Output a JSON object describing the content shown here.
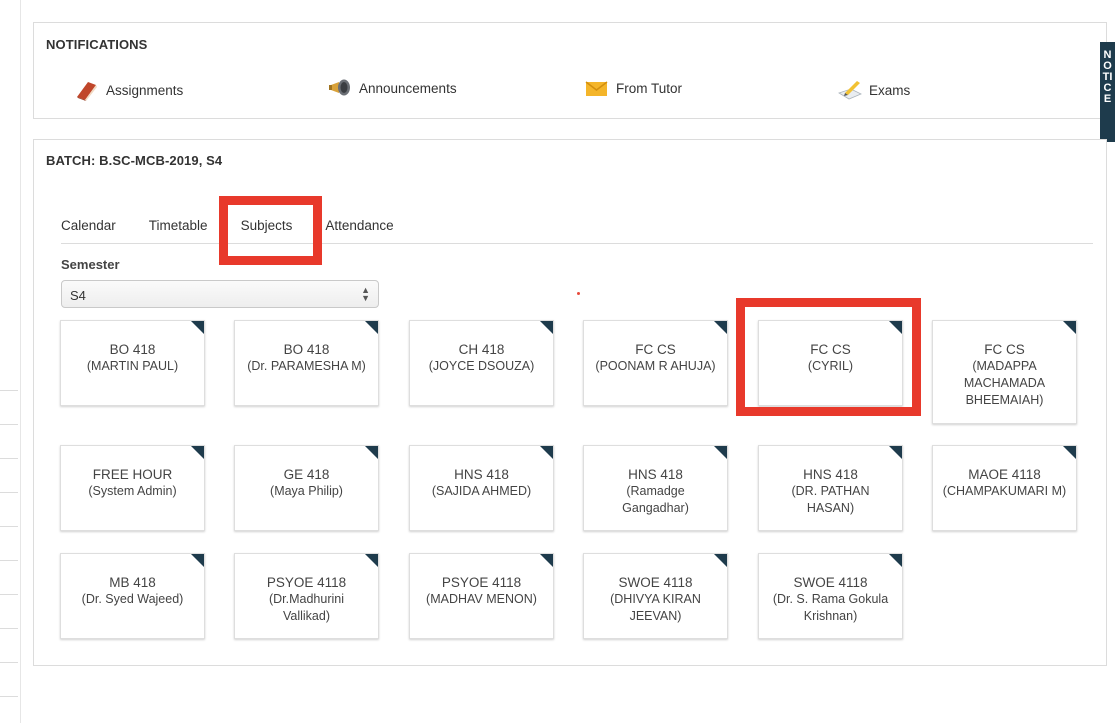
{
  "notifications": {
    "title": "NOTIFICATIONS",
    "items": [
      {
        "label": "Assignments",
        "icon": "book-icon"
      },
      {
        "label": "Announcements",
        "icon": "megaphone-icon"
      },
      {
        "label": "From Tutor",
        "icon": "envelope-icon"
      },
      {
        "label": "Exams",
        "icon": "pencil-paper-icon"
      }
    ]
  },
  "notice_tab": {
    "label": "NOTICE"
  },
  "batch": {
    "title": "BATCH: B.SC-MCB-2019, S4",
    "tabs": [
      "Calendar",
      "Timetable",
      "Subjects",
      "Attendance"
    ],
    "active_tab": "Subjects",
    "semester_label": "Semester",
    "semester_value": "S4"
  },
  "subjects": [
    {
      "code": "BO 418",
      "teacher": "(MARTIN PAUL)"
    },
    {
      "code": "BO 418",
      "teacher": "(Dr. PARAMESHA M)"
    },
    {
      "code": "CH 418",
      "teacher": "(JOYCE DSOUZA)"
    },
    {
      "code": "FC CS",
      "teacher": "(POONAM R AHUJA)"
    },
    {
      "code": "FC CS",
      "teacher": "(CYRIL)"
    },
    {
      "code": "FC CS",
      "teacher": "(MADAPPA MACHAMADA BHEEMAIAH)"
    },
    {
      "code": "FREE HOUR",
      "teacher": "(System Admin)"
    },
    {
      "code": "GE 418",
      "teacher": "(Maya Philip)"
    },
    {
      "code": "HNS 418",
      "teacher": "(SAJIDA AHMED)"
    },
    {
      "code": "HNS 418",
      "teacher": "(Ramadge Gangadhar)"
    },
    {
      "code": "HNS 418",
      "teacher": "(DR. PATHAN HASAN)"
    },
    {
      "code": "MAOE 4118",
      "teacher": "(CHAMPAKUMARI M)"
    },
    {
      "code": "MB 418",
      "teacher": "(Dr. Syed Wajeed)"
    },
    {
      "code": "PSYOE 4118",
      "teacher": "(Dr.Madhurini Vallikad)"
    },
    {
      "code": "PSYOE 4118",
      "teacher": "(MADHAV MENON)"
    },
    {
      "code": "SWOE 4118",
      "teacher": "(DHIVYA KIRAN JEEVAN)"
    },
    {
      "code": "SWOE 4118",
      "teacher": "(Dr. S. Rama Gokula Krishnan)"
    }
  ],
  "colors": {
    "accent": "#1e3b4c",
    "highlight": "#e8392b"
  }
}
